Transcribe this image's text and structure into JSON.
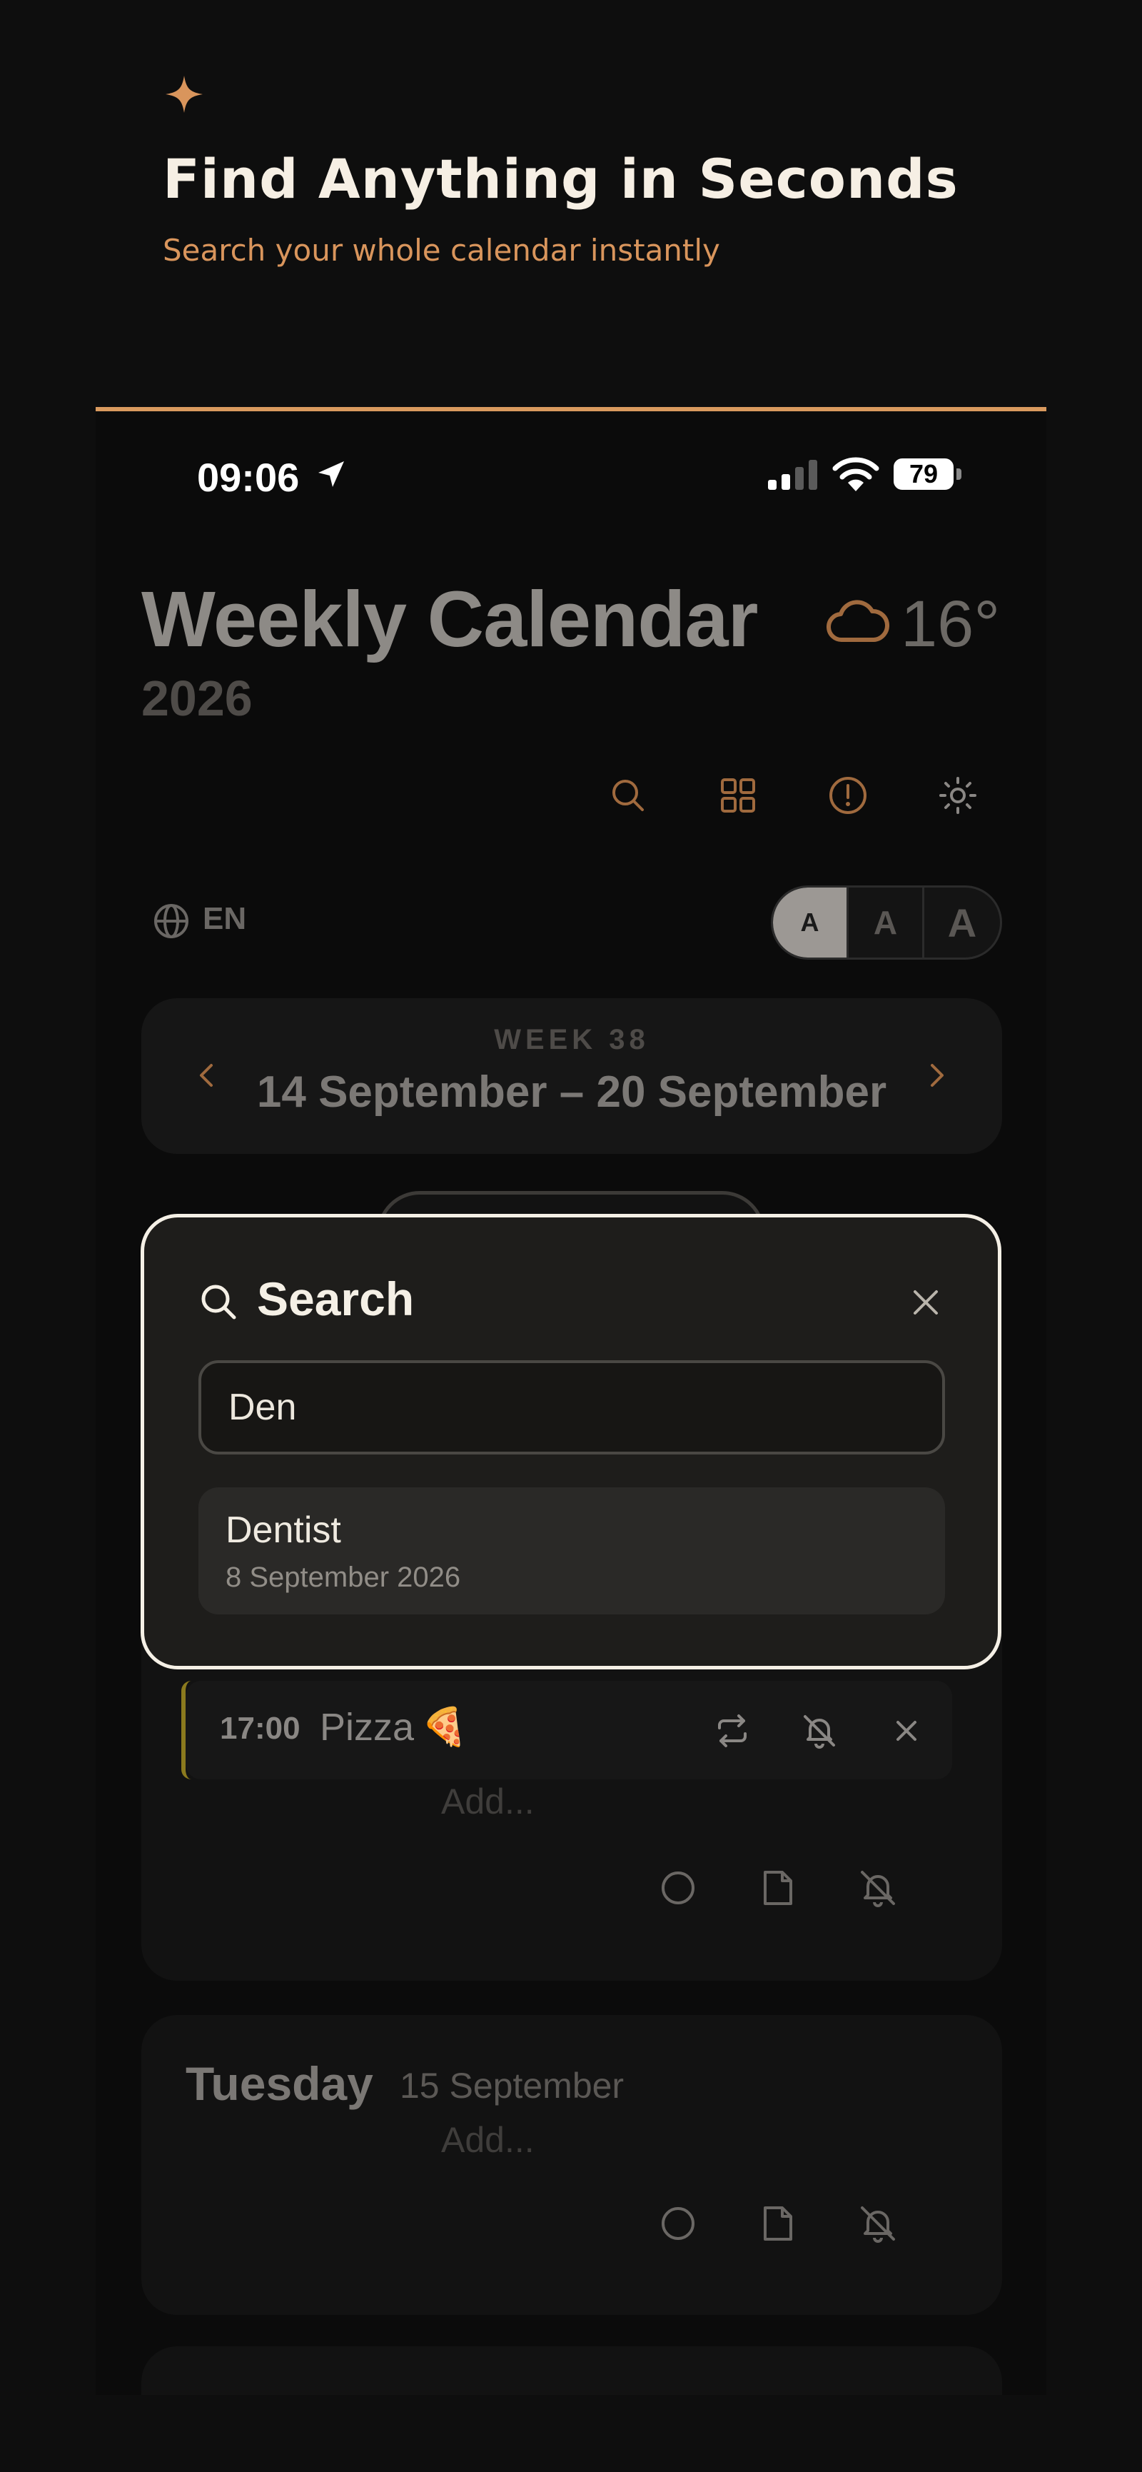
{
  "promo": {
    "icon": "sparkle-icon",
    "title": "Find Anything in Seconds",
    "subtitle": "Search your whole calendar instantly",
    "accent_color": "#d9955c"
  },
  "status_bar": {
    "time": "09:06",
    "battery": "79",
    "icons": [
      "location-arrow-icon",
      "signal-icon",
      "wifi-icon",
      "battery-icon"
    ]
  },
  "app": {
    "title": "Weekly Calendar",
    "year": "2026",
    "weather": {
      "icon": "cloud-icon",
      "temperature": "16°"
    },
    "toolbar": [
      "search-icon",
      "grid-icon",
      "alert-icon",
      "sun-icon"
    ],
    "language": "EN",
    "text_sizes": [
      "A",
      "A",
      "A"
    ],
    "text_size_selected": 0
  },
  "week": {
    "label": "WEEK 38",
    "range": "14 September – 20 September"
  },
  "days": {
    "monday": {
      "event": {
        "time": "17:00",
        "title": "Pizza",
        "emoji": "🍕"
      },
      "add_placeholder": "Add..."
    },
    "tuesday": {
      "name": "Tuesday",
      "date": "15 September",
      "add_placeholder": "Add..."
    }
  },
  "search_modal": {
    "title": "Search",
    "query": "Den",
    "results": [
      {
        "title": "Dentist",
        "date": "8 September 2026"
      }
    ]
  },
  "colors": {
    "background": "#0e0e0e",
    "accent": "#d99a5e",
    "modal_border": "#f5f0e6",
    "event_bar": "#8b7a1e"
  }
}
